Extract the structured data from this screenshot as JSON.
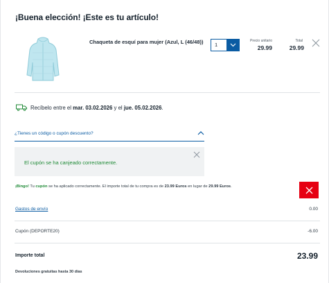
{
  "header": {
    "title": "¡Buena elección! ¡Este es tu artículo!"
  },
  "item": {
    "name": "Chaqueta de esquí para mujer (Azul, L (46/48))",
    "quantity": "1",
    "unit_price_label": "Precio unitario",
    "unit_price": "29.99",
    "total_label": "Total",
    "total_price": "29.99",
    "image_color": "#bfe6ef"
  },
  "delivery": {
    "prefix": "Recíbelo entre el ",
    "date_from": "mar. 03.02.2026",
    "middle": " y el ",
    "date_to": "jue. 05.02.2026",
    "suffix": "."
  },
  "coupon": {
    "toggle_label": "¿Tienes un código o cupón descuento?",
    "success_message": "El cupón se ha canjeado correctamente.",
    "bingo_prefix": "¡Bingo!",
    "bingo_text1": " Tu ",
    "bingo_coupon_word": "cupón",
    "bingo_text2": " se ha aplicado correctamente. El importe total de tu compra es de ",
    "bingo_new_amount": "23.99 Euros",
    "bingo_text3": " en lugar de ",
    "bingo_old_amount": "29.99 Euros",
    "bingo_text4": "."
  },
  "summary": {
    "shipping_label": "Gastos de envío",
    "shipping_value": "0.00",
    "coupon_label": "Cupón (DEPORTE20)",
    "coupon_value": "-6.00",
    "total_label": "Importe total",
    "total_value": "23.99",
    "returns_text": "Devoluciones gratuitas hasta 30 días"
  },
  "colors": {
    "accent_blue": "#0b5ca3",
    "success_green": "#1f8a36",
    "danger_red": "#e60012"
  }
}
